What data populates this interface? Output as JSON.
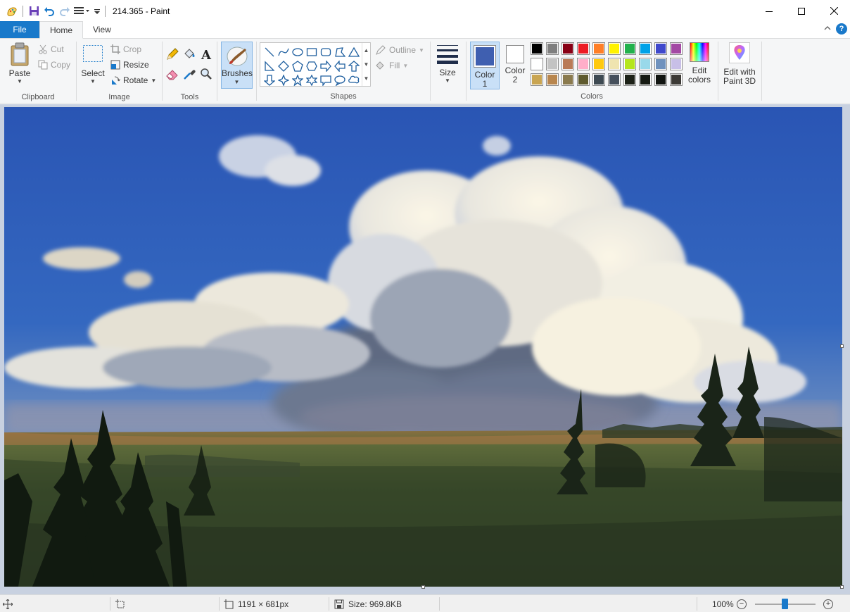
{
  "window": {
    "title": "214.365 - Paint",
    "controls": {
      "minimize": "—",
      "maximize": "☐",
      "close": "✕"
    }
  },
  "tabs": {
    "file": "File",
    "home": "Home",
    "view": "View",
    "help": "?"
  },
  "ribbon": {
    "clipboard": {
      "paste": "Paste",
      "cut": "Cut",
      "copy": "Copy",
      "label": "Clipboard"
    },
    "image": {
      "select": "Select",
      "crop": "Crop",
      "resize": "Resize",
      "rotate": "Rotate",
      "label": "Image"
    },
    "tools": {
      "label": "Tools"
    },
    "brushes": {
      "label": "Brushes"
    },
    "shapes": {
      "outline": "Outline",
      "fill": "Fill",
      "label": "Shapes"
    },
    "size": {
      "label": "Size"
    },
    "colors": {
      "color1_line1": "Color",
      "color1_line2": "1",
      "color2_line1": "Color",
      "color2_line2": "2",
      "edit_line1": "Edit",
      "edit_line2": "colors",
      "paint3d_line1": "Edit with",
      "paint3d_line2": "Paint 3D",
      "label": "Colors",
      "color1_value": "#3f5fb0",
      "color2_value": "#ffffff",
      "palette": [
        "#000000",
        "#7f7f7f",
        "#880015",
        "#ed1c24",
        "#ff7f27",
        "#fff200",
        "#22b14c",
        "#00a2e8",
        "#3f48cc",
        "#a349a4",
        "#ffffff",
        "#c3c3c3",
        "#b97a57",
        "#ffaec9",
        "#ffc90e",
        "#efe4b0",
        "#b5e61d",
        "#99d9ea",
        "#7092be",
        "#c8bfe7",
        "#c9a552",
        "#b8864e",
        "#8a7a4e",
        "#5e5a2e",
        "#3e4a52",
        "#46505c",
        "#1d2218",
        "#151a12",
        "#101410",
        "#3c3a36"
      ]
    }
  },
  "status": {
    "dimensions": "1191 × 681px",
    "size": "Size: 969.8KB",
    "zoom": "100%"
  }
}
